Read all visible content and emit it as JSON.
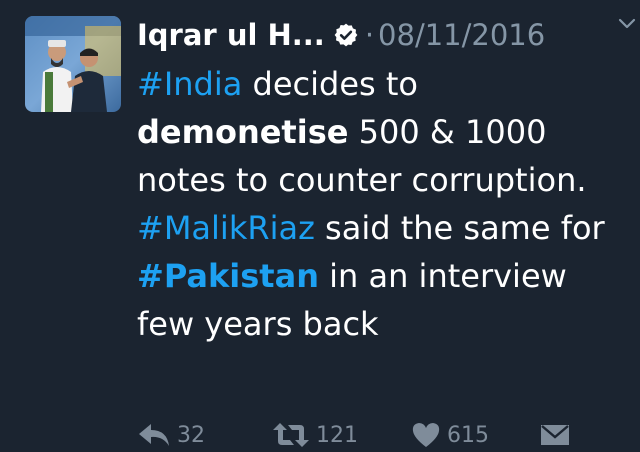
{
  "tweet": {
    "author_name": "Iqrar ul H...",
    "separator": "·",
    "date": "08/11/2016",
    "text_segments": [
      {
        "text": "#India",
        "style": "hashtag"
      },
      {
        "text": " decides to ",
        "style": "normal"
      },
      {
        "text": "demonetise",
        "style": "bold"
      },
      {
        "text": " 500 & 1000 notes to counter corruption. ",
        "style": "normal"
      },
      {
        "text": "#MalikRiaz",
        "style": "hashtag"
      },
      {
        "text": " said the same for ",
        "style": "normal"
      },
      {
        "text": "#Pakistan",
        "style": "hashtag-bold"
      },
      {
        "text": " in an interview few years back",
        "style": "normal"
      }
    ],
    "actions": {
      "reply_count": "32",
      "retweet_count": "121",
      "like_count": "615"
    }
  },
  "icons": {
    "verified": "verified-badge-icon",
    "chevron": "chevron-down-icon",
    "reply": "reply-icon",
    "retweet": "retweet-icon",
    "like": "heart-icon",
    "dm": "envelope-icon"
  },
  "colors": {
    "background": "#1b2430",
    "text": "#ffffff",
    "muted": "#8596a6",
    "hashtag": "#1da1f2",
    "action": "#7f8c9a"
  }
}
